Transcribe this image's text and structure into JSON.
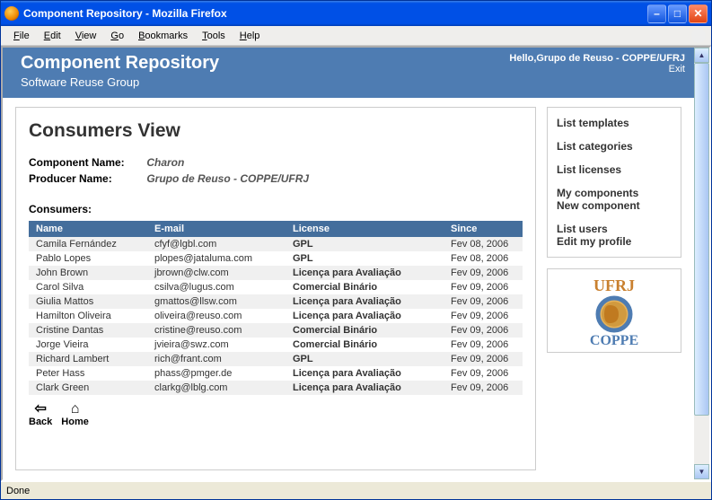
{
  "window": {
    "title": "Component Repository - Mozilla Firefox"
  },
  "menubar": [
    "File",
    "Edit",
    "View",
    "Go",
    "Bookmarks",
    "Tools",
    "Help"
  ],
  "header": {
    "title": "Component Repository",
    "subtitle": "Software Reuse Group",
    "greeting": "Hello,Grupo de Reuso - COPPE/UFRJ",
    "exit": "Exit"
  },
  "main": {
    "title": "Consumers View",
    "component_label": "Component Name:",
    "component_value": "Charon",
    "producer_label": "Producer Name:",
    "producer_value": "Grupo de Reuso - COPPE/UFRJ",
    "consumers_label": "Consumers:",
    "columns": {
      "name": "Name",
      "email": "E-mail",
      "license": "License",
      "since": "Since"
    },
    "rows": [
      {
        "name": "Camila Fernández",
        "email": "cfyf@lgbl.com",
        "license": "GPL",
        "since": "Fev 08, 2006"
      },
      {
        "name": "Pablo Lopes",
        "email": "plopes@jataluma.com",
        "license": "GPL",
        "since": "Fev 08, 2006"
      },
      {
        "name": "John Brown",
        "email": "jbrown@clw.com",
        "license": "Licença para Avaliação",
        "since": "Fev 09, 2006"
      },
      {
        "name": "Carol Silva",
        "email": "csilva@lugus.com",
        "license": "Comercial Binário",
        "since": "Fev 09, 2006"
      },
      {
        "name": "Giulia Mattos",
        "email": "gmattos@llsw.com",
        "license": "Licença para Avaliação",
        "since": "Fev 09, 2006"
      },
      {
        "name": "Hamilton Oliveira",
        "email": "oliveira@reuso.com",
        "license": "Licença para Avaliação",
        "since": "Fev 09, 2006"
      },
      {
        "name": "Cristine Dantas",
        "email": "cristine@reuso.com",
        "license": "Comercial Binário",
        "since": "Fev 09, 2006"
      },
      {
        "name": "Jorge Vieira",
        "email": "jvieira@swz.com",
        "license": "Comercial Binário",
        "since": "Fev 09, 2006"
      },
      {
        "name": "Richard Lambert",
        "email": "rich@frant.com",
        "license": "GPL",
        "since": "Fev 09, 2006"
      },
      {
        "name": "Peter Hass",
        "email": "phass@pmger.de",
        "license": "Licença para Avaliação",
        "since": "Fev 09, 2006"
      },
      {
        "name": "Clark Green",
        "email": "clarkg@lblg.com",
        "license": "Licença para Avaliação",
        "since": "Fev 09, 2006"
      }
    ],
    "footer": {
      "back": "Back",
      "home": "Home"
    }
  },
  "sidebar": {
    "groups": [
      [
        "List templates"
      ],
      [
        "List categories"
      ],
      [
        "List licenses"
      ],
      [
        "My components",
        "New component"
      ],
      [
        "List users",
        "Edit my profile"
      ]
    ]
  },
  "statusbar": {
    "text": "Done"
  }
}
